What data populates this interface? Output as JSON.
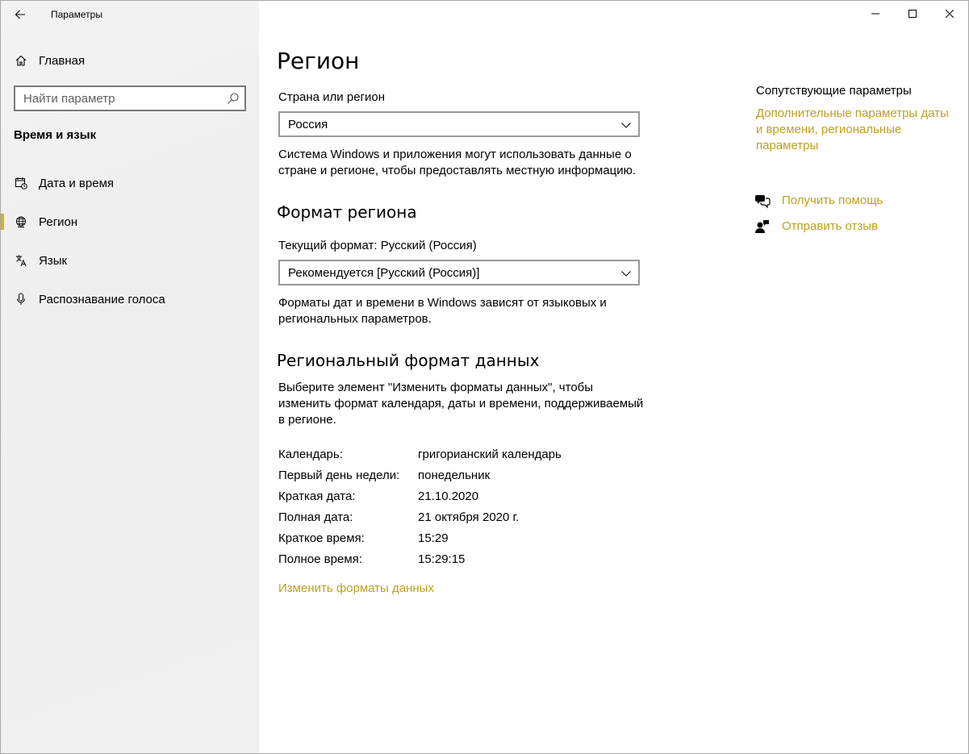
{
  "window": {
    "app_title": "Параметры",
    "accent_color": "#bea11a"
  },
  "sidebar": {
    "home_label": "Главная",
    "search_placeholder": "Найти параметр",
    "section_title": "Время и язык",
    "items": [
      {
        "label": "Дата и время",
        "icon": "calendar-clock-icon",
        "selected": false
      },
      {
        "label": "Регион",
        "icon": "globe-icon",
        "selected": true
      },
      {
        "label": "Язык",
        "icon": "language-icon",
        "selected": false
      },
      {
        "label": "Распознавание голоса",
        "icon": "microphone-icon",
        "selected": false
      }
    ]
  },
  "main": {
    "title": "Регион",
    "country": {
      "label": "Страна или регион",
      "value": "Россия",
      "description_line1": "Система Windows и приложения могут использовать данные о",
      "description_line2": "стране и регионе, чтобы предоставлять местную информацию."
    },
    "format": {
      "heading": "Формат региона",
      "current_label": "Текущий формат: Русский (Россия)",
      "value": "Рекомендуется [Русский (Россия)]",
      "description_line1": "Форматы дат и времени в Windows зависят от языковых и",
      "description_line2": "региональных параметров."
    },
    "regional_data": {
      "heading": "Региональный формат данных",
      "description_line1": "Выберите элемент \"Изменить форматы данных\", чтобы",
      "description_line2": "изменить формат календаря, даты и времени, поддерживаемый",
      "description_line3": "в регионе.",
      "rows": [
        {
          "key": "Календарь:",
          "value": "григорианский календарь"
        },
        {
          "key": "Первый день недели:",
          "value": "понедельник"
        },
        {
          "key": "Краткая дата:",
          "value": "21.10.2020"
        },
        {
          "key": "Полная дата:",
          "value": "21 октября 2020 г."
        },
        {
          "key": "Краткое время:",
          "value": "15:29"
        },
        {
          "key": "Полное время:",
          "value": "15:29:15"
        }
      ],
      "change_link": "Изменить форматы данных"
    }
  },
  "related": {
    "title": "Сопутствующие параметры",
    "link_line1": "Дополнительные параметры даты",
    "link_line2": "и времени, региональные",
    "link_line3": "параметры",
    "help_label": "Получить помощь",
    "feedback_label": "Отправить отзыв"
  }
}
